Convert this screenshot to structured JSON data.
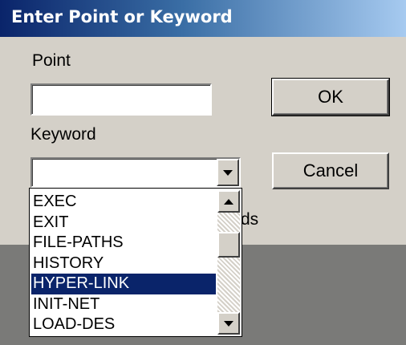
{
  "dialog": {
    "title": "Enter Point or Keyword",
    "point_label": "Point",
    "point_value": "",
    "keyword_label": "Keyword",
    "keyword_value": "",
    "ok_label": "OK",
    "cancel_label": "Cancel",
    "hidden_text_fragment": "ds"
  },
  "keyword_list": {
    "items": [
      "EXEC",
      "EXIT",
      "FILE-PATHS",
      "HISTORY",
      "HYPER-LINK",
      "INIT-NET",
      "LOAD-DES"
    ],
    "selected_index": 4,
    "selected_item": "HYPER-LINK"
  },
  "colors": {
    "title_bar_start": "#0a246a",
    "title_bar_end": "#a6caf0",
    "dialog_face": "#d4d0c8",
    "selection": "#0a246a"
  },
  "icons": {
    "combo_dropdown": "triangle-down",
    "scroll_up": "triangle-up",
    "scroll_down": "triangle-down"
  }
}
